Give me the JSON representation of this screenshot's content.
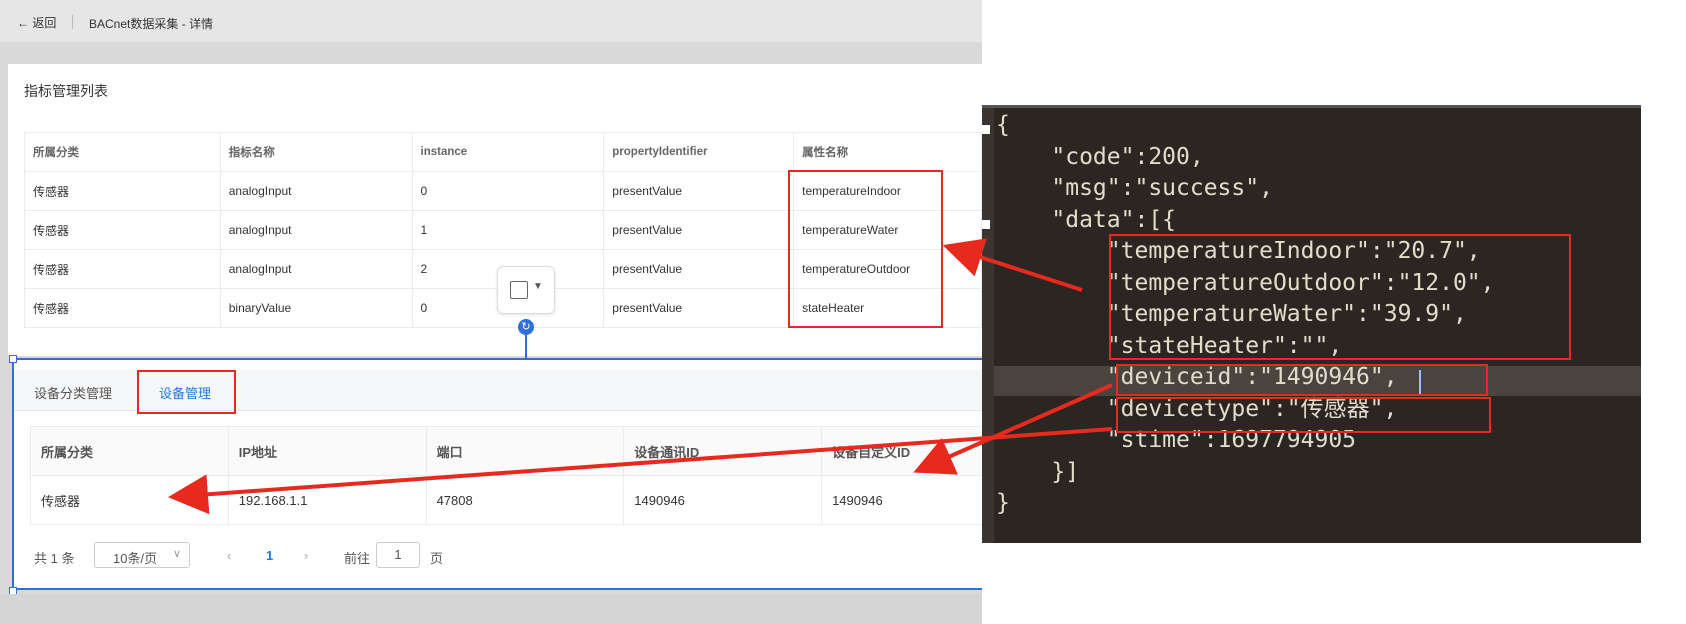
{
  "topbar": {
    "back_label": "← 返回",
    "title": "BACnet数据采集 - 详情"
  },
  "metrics": {
    "title": "指标管理列表",
    "columns": [
      "所属分类",
      "指标名称",
      "instance",
      "propertyIdentifier",
      "属性名称"
    ],
    "rows": [
      [
        "传感器",
        "analogInput",
        "0",
        "presentValue",
        "temperatureIndoor"
      ],
      [
        "传感器",
        "analogInput",
        "1",
        "presentValue",
        "temperatureWater"
      ],
      [
        "传感器",
        "analogInput",
        "2",
        "presentValue",
        "temperatureOutdoor"
      ],
      [
        "传感器",
        "binaryValue",
        "0",
        "presentValue",
        "stateHeater"
      ]
    ]
  },
  "device": {
    "tabs": [
      "设备分类管理",
      "设备管理"
    ],
    "active_tab": "设备管理",
    "columns": [
      "所属分类",
      "IP地址",
      "端口",
      "设备通讯ID",
      "设备自定义ID"
    ],
    "rows": [
      [
        "传感器",
        "192.168.1.1",
        "47808",
        "1490946",
        "1490946"
      ]
    ],
    "pagination": {
      "total": "共 1 条",
      "page_size": "10条/页",
      "current": "1",
      "goto_label": "前往",
      "goto_value": "1",
      "page_suffix": "页"
    }
  },
  "editor": {
    "lines": [
      "{",
      "    \"code\":200,",
      "    \"msg\":\"success\",",
      "    \"data\":[{",
      "        \"temperatureIndoor\":\"20.7\",",
      "        \"temperatureOutdoor\":\"12.0\",",
      "        \"temperatureWater\":\"39.9\",",
      "        \"stateHeater\":\"\",",
      "        \"deviceid\":\"1490946\",",
      "        \"devicetype\":\"传感器\",",
      "        \"stime\":1697794905",
      "    }]",
      "}"
    ]
  },
  "colors": {
    "annotation_red": "#e8291d",
    "link_blue": "#1f7ae0",
    "selection_blue": "#2f6fd6",
    "editor_bg": "#2b2622"
  },
  "icons": {
    "refresh": "refresh-icon",
    "fullscreen": "fullscreen-icon",
    "dropdown": "chevron-down-icon",
    "prev": "chevron-left-icon",
    "next": "chevron-right-icon"
  }
}
